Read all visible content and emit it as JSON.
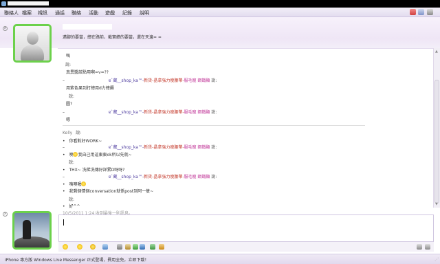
{
  "window": {
    "title": ""
  },
  "menu": {
    "items": [
      "聯絡人",
      "檔案",
      "視訊",
      "通話",
      "聯絡",
      "活動",
      "遊戲",
      "記錄",
      "說明"
    ],
    "colors": {
      "accent": "#6cd14b",
      "header_bg": "#efe6f6"
    }
  },
  "contact": {
    "name": "",
    "psm": "邁腳的要當，總在路前，截實績的要當，還在天邊= ="
  },
  "conversation": {
    "lines": [
      {
        "text": "嗎"
      },
      {
        "sender": "",
        "said": "說:"
      },
      {
        "text": "真異醬該點用啊=v=??"
      },
      {
        "sender_parts": [
          "ɐ`蔵__shop_ka™-",
          "新貨-晶拿強力瘦腰帶-",
          "服毛寵 鋼鐵顯"
        ],
        "said": "說:"
      },
      {
        "text": "用紫色果到打總用d力總攝"
      },
      {
        "said": "說:"
      },
      {
        "text": "圖?"
      },
      {
        "sender_parts": [
          "ɐ`蔵__shop_ka™-",
          "新貨-晶拿強力瘦腰帶-",
          "服毛寵 鋼鐵顯"
        ],
        "said": "說:"
      },
      {
        "text": "嗯"
      },
      {
        "sender": "Kelly",
        "said": "說:"
      },
      {
        "text": "你看對好WORK~"
      },
      {
        "sender_parts": [
          "ɐ`蔵__shop_ka™-",
          "新貨-晶拿強力瘦腰帶-",
          "服毛寵 鋼鐵顯"
        ],
        "said": "說:"
      },
      {
        "text_before": "噢",
        "text_after": "我自己用這東東ok所以先就~"
      },
      {
        "said": "說:"
      },
      {
        "text": "THX~ 洗稀洗傳好詳累D呀呀?"
      },
      {
        "sender_parts": [
          "ɐ`蔵__shop_ka™-",
          "新貨-晶拿強力瘦腰帶-",
          "服毛寵 鋼鐵顯"
        ],
        "said": "說:"
      },
      {
        "text_before": "咦噢喔",
        "text_after": ""
      },
      {
        "text": "我剩個情個conversation就係post到阿一隻~"
      },
      {
        "said": "說:"
      },
      {
        "text": "好^^"
      }
    ],
    "timestamp": "10/5/2011 1:24 收到最後一則訊息。"
  },
  "statusbar": {
    "ad": "iPhone 專方版 Windows Live Messenger 正式登場，費用全免，立即下載！"
  }
}
